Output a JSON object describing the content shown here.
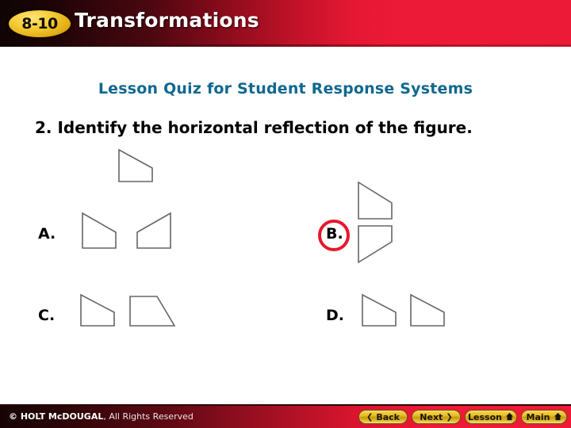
{
  "header": {
    "chapter_badge": "8-10",
    "title": "Transformations",
    "accent_red": "#ed1a37",
    "badge_gold": "#e2ad13"
  },
  "quiz": {
    "heading": "Lesson Quiz for Student Response Systems",
    "heading_color": "#10688f",
    "question_number": "2.",
    "question_text": "2. Identify the horizontal reflection of the figure.",
    "selected_option": "B",
    "selection_ring_color": "#e8172b",
    "options": [
      {
        "letter": "A.",
        "kind": "horizontal-reflection-pair"
      },
      {
        "letter": "B.",
        "kind": "vertical-reflection-pair"
      },
      {
        "letter": "C.",
        "kind": "rotation-pair"
      },
      {
        "letter": "D.",
        "kind": "translation-pair"
      }
    ]
  },
  "footer": {
    "copyright_bold": "© HOLT McDOUGAL",
    "copyright_rest": ", All Rights Reserved",
    "buttons": [
      {
        "label": "Back",
        "icon": "chevron-left-icon",
        "glyph": "❮"
      },
      {
        "label": "Next",
        "icon": "chevron-right-icon",
        "glyph": "❯"
      },
      {
        "label": "Lesson",
        "icon": "home-icon",
        "glyph": "⌂"
      },
      {
        "label": "Main",
        "icon": "home-icon",
        "glyph": "⌂"
      }
    ]
  }
}
